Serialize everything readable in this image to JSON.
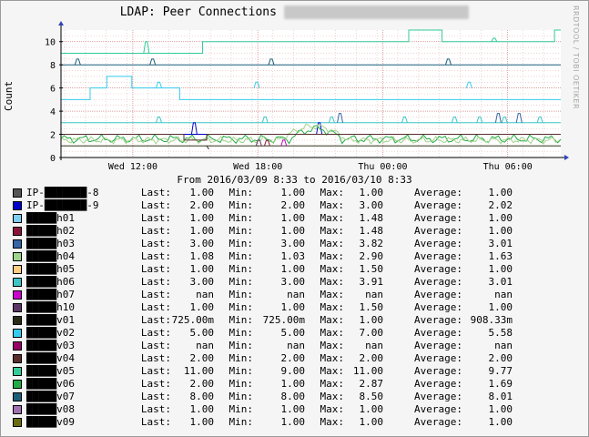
{
  "title_prefix": "LDAP: Peer Connections",
  "title_blurred": "████████ █████ ██ ████████",
  "watermark": "RRDTOOL / TOBI OETIKER",
  "period": "From 2016/03/09 8:33 to 2016/03/10 8:33",
  "legend_labels": {
    "last": "Last:",
    "min": "Min:",
    "max": "Max:",
    "avg": "Average:"
  },
  "chart_data": {
    "type": "line",
    "title": "LDAP: Peer Connections",
    "ylabel": "Count",
    "ylim": [
      0,
      11
    ],
    "yticks": [
      0,
      2,
      4,
      6,
      8,
      10
    ],
    "xticks": [
      "Wed 12:00",
      "Wed 18:00",
      "Thu 00:00",
      "Thu 06:00"
    ],
    "xrange_hours": [
      "2016/03/09 8:33",
      "2016/03/10 8:33"
    ],
    "grid": true,
    "series": [
      {
        "name": "IP-███████-8",
        "color": "#555555",
        "last": "1.00",
        "min": "1.00",
        "max": "1.00",
        "avg": "1.00"
      },
      {
        "name": "IP-███████-9",
        "color": "#0000cc",
        "last": "2.00",
        "min": "2.00",
        "max": "3.00",
        "avg": "2.02"
      },
      {
        "name": "█████h01",
        "color": "#7ecef4",
        "last": "1.00",
        "min": "1.00",
        "max": "1.48",
        "avg": "1.00"
      },
      {
        "name": "█████h02",
        "color": "#8b1538",
        "last": "1.00",
        "min": "1.00",
        "max": "1.48",
        "avg": "1.00"
      },
      {
        "name": "█████h03",
        "color": "#3465a4",
        "last": "3.00",
        "min": "3.00",
        "max": "3.82",
        "avg": "3.01"
      },
      {
        "name": "█████h04",
        "color": "#9fd48a",
        "last": "1.08",
        "min": "1.03",
        "max": "2.90",
        "avg": "1.63"
      },
      {
        "name": "█████h05",
        "color": "#ffcc80",
        "last": "1.00",
        "min": "1.00",
        "max": "1.50",
        "avg": "1.00"
      },
      {
        "name": "█████h06",
        "color": "#3cc6c6",
        "last": "3.00",
        "min": "3.00",
        "max": "3.91",
        "avg": "3.01"
      },
      {
        "name": "█████h07",
        "color": "#cc00cc",
        "last": "nan",
        "min": "nan",
        "max": "nan",
        "avg": "nan"
      },
      {
        "name": "█████h10",
        "color": "#5c3566",
        "last": "1.00",
        "min": "1.00",
        "max": "1.50",
        "avg": "1.00"
      },
      {
        "name": "█████v01",
        "color": "#2a2a14",
        "last": "725.00m",
        "min": "725.00m",
        "max": "1.00",
        "avg": "908.33m"
      },
      {
        "name": "█████v02",
        "color": "#33ccee",
        "last": "5.00",
        "min": "5.00",
        "max": "7.00",
        "avg": "5.58"
      },
      {
        "name": "█████v03",
        "color": "#990066",
        "last": "nan",
        "min": "nan",
        "max": "nan",
        "avg": "nan"
      },
      {
        "name": "█████v04",
        "color": "#5a2d2d",
        "last": "2.00",
        "min": "2.00",
        "max": "2.00",
        "avg": "2.00"
      },
      {
        "name": "█████v05",
        "color": "#33cc99",
        "last": "11.00",
        "min": "9.00",
        "max": "11.00",
        "avg": "9.77"
      },
      {
        "name": "█████v06",
        "color": "#22aa44",
        "last": "2.00",
        "min": "1.00",
        "max": "2.87",
        "avg": "1.69"
      },
      {
        "name": "█████v07",
        "color": "#1a5f7a",
        "last": "8.00",
        "min": "8.00",
        "max": "8.50",
        "avg": "8.01"
      },
      {
        "name": "█████v08",
        "color": "#a070b0",
        "last": "1.00",
        "min": "1.00",
        "max": "1.00",
        "avg": "1.00"
      },
      {
        "name": "█████v09",
        "color": "#6b6b10",
        "last": "1.00",
        "min": "1.00",
        "max": "1.00",
        "avg": "1.00"
      }
    ]
  }
}
